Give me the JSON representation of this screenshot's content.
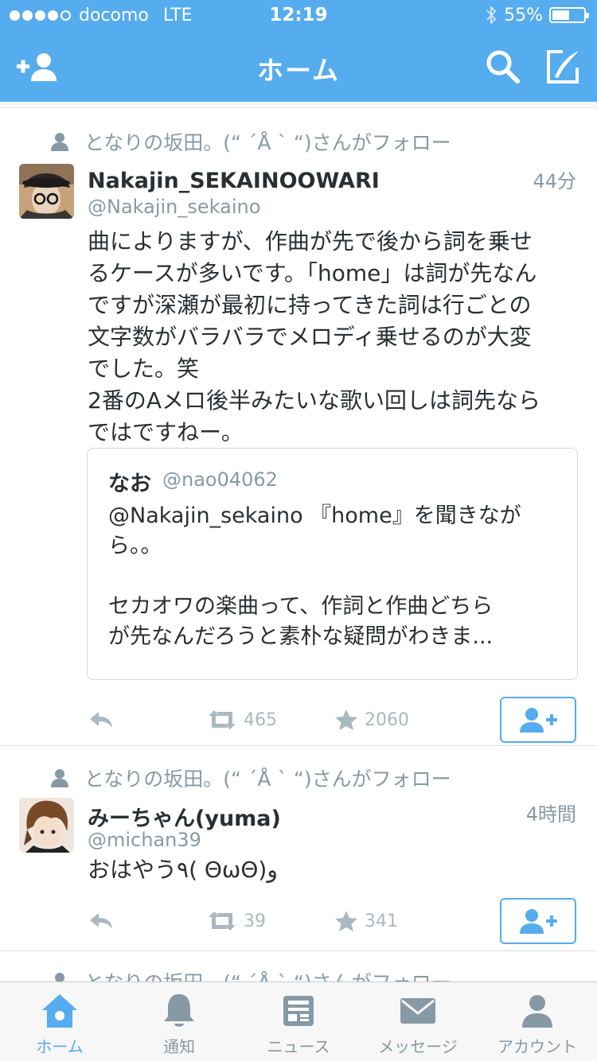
{
  "status_bar": {
    "carrier": "docomo",
    "network": "LTE",
    "time": "12:19",
    "battery": "55%",
    "battery_level": 0.55,
    "signal_bars": 4,
    "signal_max": 5
  },
  "nav": {
    "title": "ホーム",
    "left_icon": "add-user-icon",
    "right_icons": [
      "search-icon",
      "compose-icon"
    ]
  },
  "tweets": [
    {
      "context": "となりの坂田。(“ ´Å ` “)さんがフォロー",
      "name": "Nakajin_SEKAINOOWARI",
      "handle": "@Nakajin_sekaino",
      "time": "44分",
      "body_lines": [
        "曲によりますが、作曲が先で後から詞を乗せ",
        "るケースが多いです。「home」は詞が先なん",
        "ですが深瀬が最初に持ってきた詞は行ごとの",
        "文字数がバラバラでメロディ乗せるのが大変",
        "でした。笑",
        "2番のAメロ後半みたいな歌い回しは詞先なら",
        "ではですねー。"
      ],
      "quote": {
        "name": "なお",
        "handle": "@nao04062",
        "body_lines": [
          "@Nakajin_sekaino 『home』を聞きなが",
          "ら。。",
          "",
          "セカオワの楽曲って、作詞と作曲どちら",
          "が先なんだろうと素朴な疑問がわきま..."
        ]
      },
      "retweets": "465",
      "favorites": "2060"
    },
    {
      "context": "となりの坂田。(“ ´Å ` “)さんがフォロー",
      "name": "みーちゃん(yuma)",
      "handle": "@michan39",
      "time": "4時間",
      "body_lines": [
        "おはやう٩( ΘωΘ)و"
      ],
      "retweets": "39",
      "favorites": "341"
    },
    {
      "context": "となりの坂田。(“ ´Å ` “)さんがフォロー"
    }
  ],
  "tabbar": {
    "active": "home",
    "items": [
      {
        "label": "ホーム",
        "icon": "home-icon"
      },
      {
        "label": "通知",
        "icon": "bell-icon"
      },
      {
        "label": "ニュース",
        "icon": "news-icon"
      },
      {
        "label": "メッセージ",
        "icon": "envelope-icon"
      },
      {
        "label": "アカウント",
        "icon": "person-icon"
      }
    ]
  },
  "colors": {
    "brand": "#55acee",
    "text": "#292f33",
    "muted": "#8899a6",
    "icon_muted": "#aab8c2"
  }
}
